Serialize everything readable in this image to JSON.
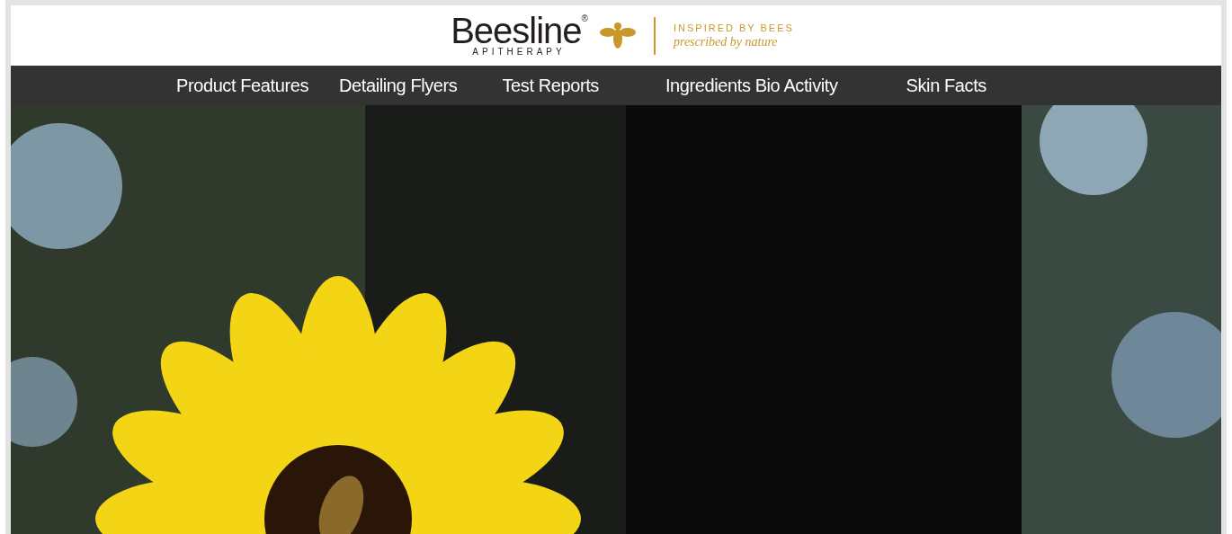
{
  "header": {
    "logo_text": "Beesline$^{®}$",
    "logo_subtext": "APITHERAPY",
    "tagline": "INSPIRED BY BEES",
    "slogan": "prescribed by nature"
  },
  "nav": [
    {
      "label": "Product Features"
    },
    {
      "label": "Detailing Flyers"
    },
    {
      "label": "Test Reports"
    },
    {
      "label": "Ingredients Bio Activity"
    },
    {
      "label": "Skin Facts"
    }
  ]
}
